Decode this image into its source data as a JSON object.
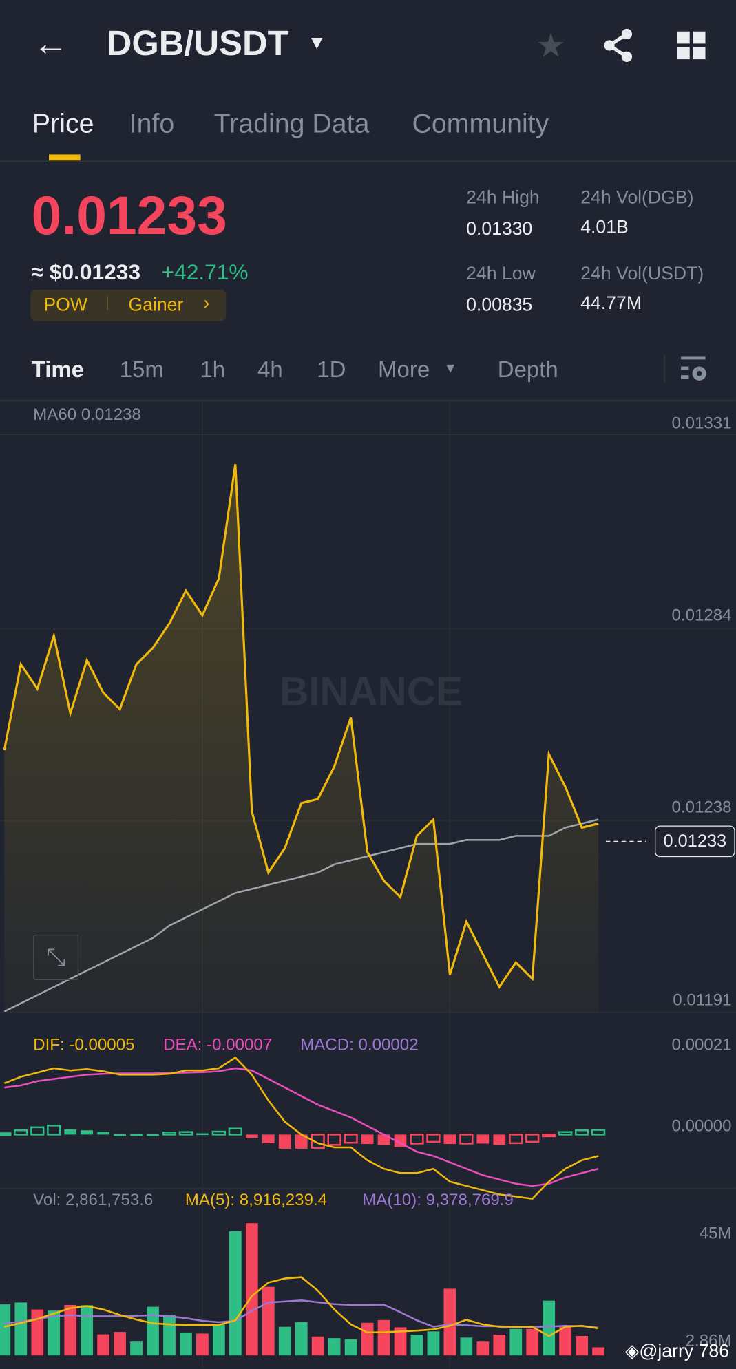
{
  "header": {
    "pair": "DGB/USDT"
  },
  "tabs": [
    {
      "label": "Price"
    },
    {
      "label": "Info"
    },
    {
      "label": "Trading Data"
    },
    {
      "label": "Community"
    }
  ],
  "ticker": {
    "last_price": "0.01233",
    "usd_price": "≈ $0.01233",
    "change": "+42.71%",
    "tag1": "POW",
    "tag2": "Gainer",
    "high_label": "24h High",
    "high": "0.01330",
    "low_label": "24h Low",
    "low": "0.00835",
    "vol_base_label": "24h Vol(DGB)",
    "vol_base": "4.01B",
    "vol_quote_label": "24h Vol(USDT)",
    "vol_quote": "44.77M"
  },
  "intervals": {
    "time": "Time",
    "i15m": "15m",
    "i1h": "1h",
    "i4h": "4h",
    "i1d": "1D",
    "more": "More",
    "depth": "Depth"
  },
  "colors": {
    "up": "#2ebd85",
    "down": "#f6465d",
    "accent": "#f0b90b",
    "dea": "#e84fbd",
    "macd": "#9d77d4",
    "ma60": "#a0a4ac"
  },
  "watermark": "BINANCE",
  "credit": "@jarry 786",
  "chart_data": [
    {
      "type": "line",
      "title": "MA60 0.01238",
      "y_ticks": [
        "0.01331",
        "0.01284",
        "0.01238",
        "0.01191"
      ],
      "ylim": [
        0.01191,
        0.01331
      ],
      "current": "0.01233",
      "price": [
        0.01251,
        0.01272,
        0.01266,
        0.01279,
        0.0126,
        0.01273,
        0.01265,
        0.01261,
        0.01272,
        0.01276,
        0.01282,
        0.0129,
        0.01284,
        0.01293,
        0.01321,
        0.01236,
        0.01221,
        0.01227,
        0.01238,
        0.01239,
        0.01247,
        0.01259,
        0.01226,
        0.01219,
        0.01215,
        0.0123,
        0.01234,
        0.01196,
        0.01209,
        0.01201,
        0.01193,
        0.01199,
        0.01195,
        0.0125,
        0.01242,
        0.01232,
        0.01233
      ],
      "ma60": [
        0.01187,
        0.01189,
        0.01191,
        0.01193,
        0.01195,
        0.01197,
        0.01199,
        0.01201,
        0.01203,
        0.01205,
        0.01208,
        0.0121,
        0.01212,
        0.01214,
        0.01216,
        0.01217,
        0.01218,
        0.01219,
        0.0122,
        0.01221,
        0.01223,
        0.01224,
        0.01225,
        0.01226,
        0.01227,
        0.01228,
        0.01228,
        0.01228,
        0.01229,
        0.01229,
        0.01229,
        0.0123,
        0.0123,
        0.0123,
        0.01232,
        0.01233,
        0.01234
      ]
    },
    {
      "type": "bar",
      "name": "MACD",
      "dif_label": "DIF: -0.00005",
      "dea_label": "DEA: -0.00007",
      "macd_label": "MACD: 0.00002",
      "y_ticks": [
        "0.00021",
        "0.00000"
      ],
      "unit": "1e-5",
      "hist": [
        0.3,
        1,
        1.7,
        2.1,
        1.2,
        1,
        0.6,
        0.1,
        0.1,
        0.1,
        0.5,
        0.6,
        0.3,
        0.7,
        1.4,
        -0.8,
        -2,
        -3.3,
        -3.3,
        -3.1,
        -2.4,
        -1.9,
        -2.2,
        -2.4,
        -2.9,
        -2.1,
        -1.7,
        -2.2,
        -2.1,
        -2.1,
        -2.4,
        -2,
        -1.7,
        -0.4,
        0.6,
        1,
        1.1
      ],
      "dif": [
        12,
        13.5,
        14.5,
        15.5,
        15,
        15.3,
        14.8,
        14,
        14,
        14,
        14.2,
        15,
        15,
        15.5,
        18,
        14,
        8,
        3,
        0,
        -2,
        -3,
        -3,
        -6,
        -8,
        -9,
        -9,
        -8,
        -11,
        -12,
        -13,
        -14,
        -14.5,
        -15,
        -11,
        -8,
        -6,
        -5
      ],
      "dea": [
        11,
        11.5,
        12.5,
        13,
        13.5,
        14,
        14.2,
        14.3,
        14.3,
        14.3,
        14.4,
        14.5,
        14.6,
        14.8,
        15.5,
        15,
        13,
        11,
        9,
        7,
        5.5,
        4,
        2,
        0,
        -2,
        -4,
        -5,
        -6.5,
        -8,
        -9.5,
        -10.5,
        -11.5,
        -12,
        -11.5,
        -10,
        -9,
        -8
      ]
    },
    {
      "type": "bar",
      "name": "Volume",
      "vol_label": "Vol: 2,861,753.6",
      "ma5_label": "MA(5): 8,916,239.4",
      "ma10_label": "MA(10): 9,378,769.9",
      "y_ticks": [
        "45M",
        "2.86M"
      ],
      "unit": "M",
      "volume": [
        18.9,
        19.6,
        17,
        16.6,
        18.7,
        18.6,
        7.8,
        8.7,
        5.1,
        18,
        14.9,
        8.5,
        8.1,
        11.5,
        46,
        49,
        25.4,
        10.6,
        12.3,
        7,
        6.4,
        6,
        12.1,
        13.1,
        10.4,
        7.7,
        8.9,
        24.7,
        6.6,
        5.1,
        7.7,
        9.8,
        9.8,
        20.3,
        11.1,
        7.2,
        3
      ],
      "up": [
        1,
        1,
        0,
        1,
        0,
        1,
        0,
        0,
        1,
        1,
        1,
        1,
        0,
        1,
        1,
        0,
        0,
        1,
        1,
        0,
        1,
        1,
        0,
        0,
        0,
        1,
        1,
        0,
        1,
        0,
        0,
        1,
        0,
        1,
        0,
        0,
        0
      ],
      "ma5": [
        10.6,
        12,
        13.5,
        15.5,
        17.5,
        18.3,
        17,
        15,
        13.3,
        11.9,
        11.5,
        11.3,
        11.3,
        11.3,
        13,
        22,
        27,
        28.5,
        29,
        24,
        17,
        11.5,
        8.5,
        8.6,
        8.9,
        9.2,
        9.6,
        11,
        13.2,
        11.5,
        10.6,
        10.6,
        10.6,
        7.2,
        10.6,
        11,
        10
      ],
      "ma10": [
        11.9,
        12.5,
        13.5,
        14.5,
        14.9,
        14.5,
        14.5,
        14.5,
        14.7,
        14.9,
        14.5,
        13.8,
        12.8,
        12.3,
        12.8,
        16.5,
        19.6,
        20,
        20.4,
        19.7,
        19,
        18.7,
        18.7,
        18.8,
        16,
        13,
        10.6,
        11.5,
        11.2,
        10.8,
        10.8,
        10.6,
        10.6,
        10.6,
        11,
        10.8,
        10.3
      ]
    }
  ]
}
